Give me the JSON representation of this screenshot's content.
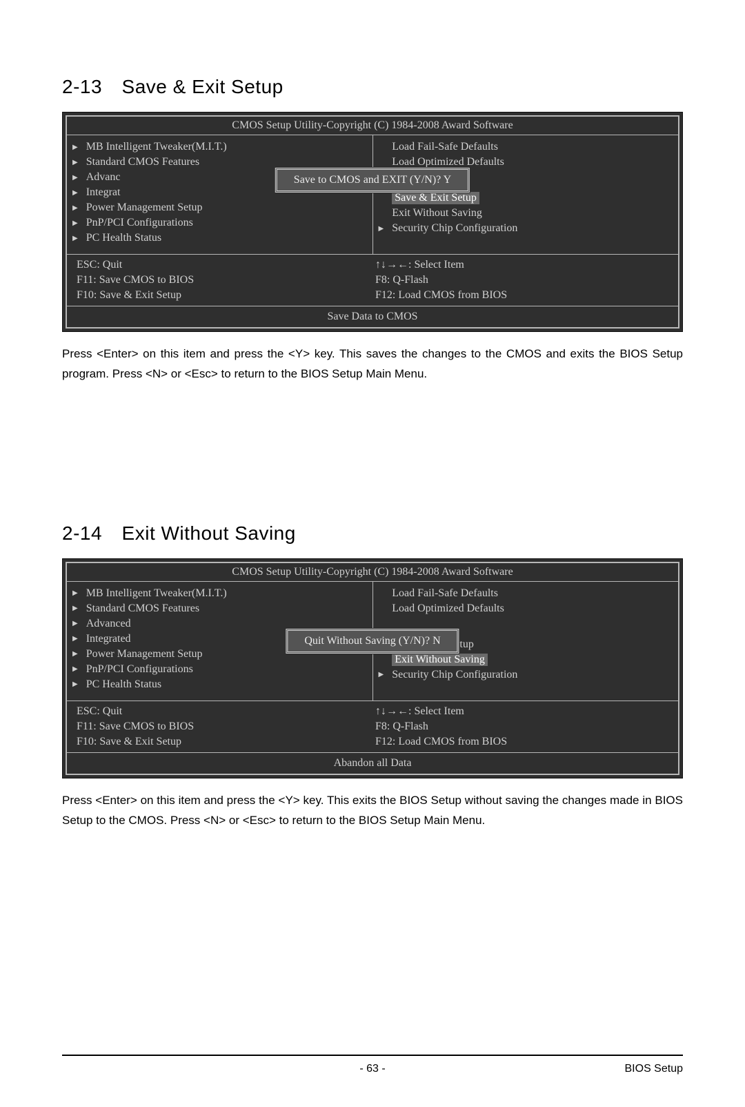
{
  "section1": {
    "heading": "2-13 Save & Exit Setup",
    "explain": "Press <Enter> on this item and press the <Y> key. This saves the changes to the CMOS and exits the BIOS Setup program. Press <N> or <Esc> to return to the BIOS Setup Main Menu."
  },
  "section2": {
    "heading": "2-14 Exit Without Saving",
    "explain": "Press <Enter> on this item and press the <Y> key. This exits the BIOS Setup without saving the changes made in BIOS Setup to the CMOS. Press <N> or <Esc> to return to the BIOS Setup Main Menu."
  },
  "bios1": {
    "title": "CMOS Setup Utility-Copyright (C) 1984-2008 Award Software",
    "left_items": [
      "MB Intelligent Tweaker(M.I.T.)",
      "Standard CMOS Features",
      "Advanc",
      "Integrat",
      "Power Management Setup",
      "PnP/PCI Configurations",
      "PC Health Status"
    ],
    "right_items": [
      {
        "text": "Load Fail-Safe Defaults",
        "arrow": false,
        "hl": false
      },
      {
        "text": "Load Optimized Defaults",
        "arrow": false,
        "hl": false
      },
      {
        "text": "",
        "arrow": false,
        "hl": false
      },
      {
        "text": "",
        "arrow": false,
        "hl": false
      },
      {
        "text": "Save & Exit Setup",
        "arrow": false,
        "hl": true
      },
      {
        "text": "Exit Without Saving",
        "arrow": false,
        "hl": false
      },
      {
        "text": "Security Chip Configuration",
        "arrow": true,
        "hl": false
      }
    ],
    "dialog": "Save to CMOS and EXIT (Y/N)? Y",
    "help": {
      "a1": "ESC: Quit",
      "a2": "↑↓→←: Select Item",
      "a3": "F11: Save CMOS to BIOS",
      "b1": "F8: Q-Flash",
      "b2": "F10: Save & Exit Setup",
      "b3": "F12: Load CMOS from BIOS"
    },
    "status": "Save Data to CMOS"
  },
  "bios2": {
    "title": "CMOS Setup Utility-Copyright (C) 1984-2008 Award Software",
    "left_items": [
      "MB Intelligent Tweaker(M.I.T.)",
      "Standard CMOS Features",
      "Advanced",
      "Integrated",
      "Power Management Setup",
      "PnP/PCI Configurations",
      "PC Health Status"
    ],
    "right_items": [
      {
        "text": "Load Fail-Safe Defaults",
        "arrow": false,
        "hl": false
      },
      {
        "text": "Load Optimized Defaults",
        "arrow": false,
        "hl": false
      },
      {
        "text": "",
        "arrow": false,
        "hl": false
      },
      {
        "text": "",
        "arrow": false,
        "hl": false
      },
      {
        "text": "Save & Exit Setup",
        "arrow": false,
        "hl": false
      },
      {
        "text": "Exit Without Saving",
        "arrow": false,
        "hl": true
      },
      {
        "text": "Security Chip Configuration",
        "arrow": true,
        "hl": false
      }
    ],
    "dialog": "Quit Without Saving (Y/N)? N",
    "help": {
      "a1": "ESC: Quit",
      "a2": "↑↓→←: Select Item",
      "a3": "F11: Save CMOS to BIOS",
      "b1": "F8: Q-Flash",
      "b2": "F10: Save & Exit Setup",
      "b3": "F12: Load CMOS from BIOS"
    },
    "status": "Abandon all Data"
  },
  "footer": {
    "page_no": "- 63 -",
    "chapter": "BIOS Setup"
  }
}
